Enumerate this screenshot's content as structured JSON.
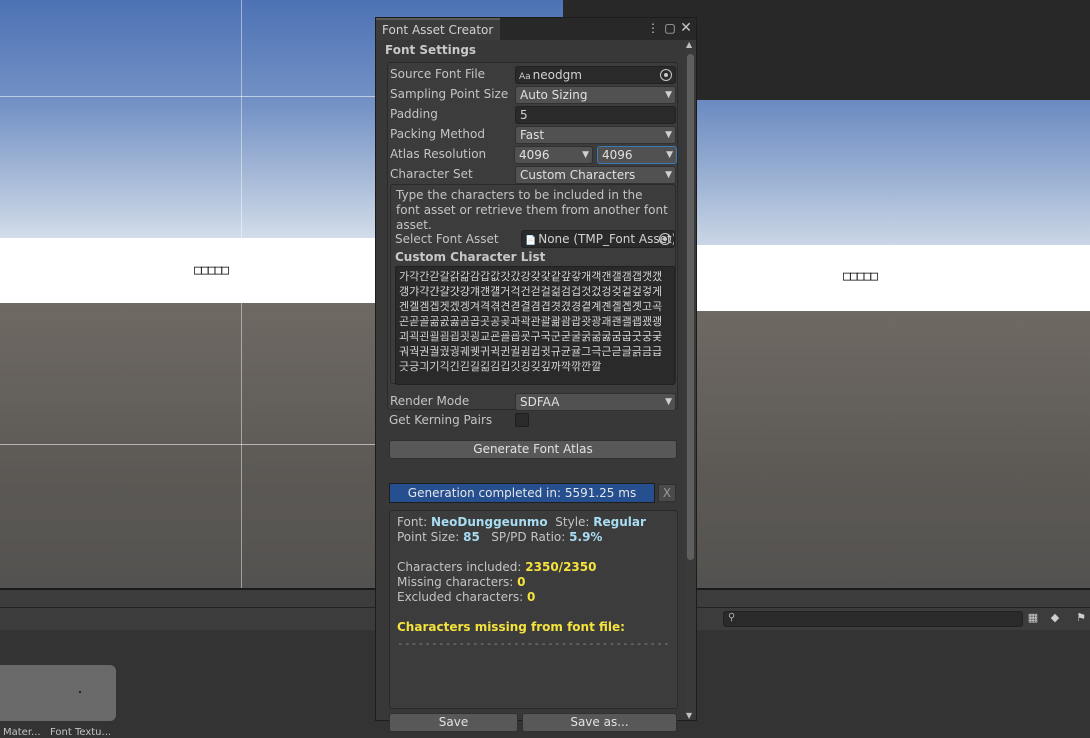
{
  "scene_left": {
    "glyphs": "□□□□□"
  },
  "scene_right": {
    "glyphs": "□□□□□"
  },
  "project": {
    "assets": [
      "Mater...",
      "Font Textu..."
    ]
  },
  "window": {
    "tab_title": "Font Asset Creator",
    "menu_icon": "kebab-menu-icon",
    "maximize_icon": "maximize-icon",
    "close_icon": "close-icon"
  },
  "settings": {
    "section_title": "Font Settings",
    "source_font_label": "Source Font File",
    "source_font_value": "neodgm",
    "sampling_label": "Sampling Point Size",
    "sampling_value": "Auto Sizing",
    "padding_label": "Padding",
    "padding_value": "5",
    "packing_label": "Packing Method",
    "packing_value": "Fast",
    "atlas_label": "Atlas Resolution",
    "atlas_width": "4096",
    "atlas_height": "4096",
    "charset_label": "Character Set",
    "charset_value": "Custom Characters",
    "charset_help": "Type the characters to be included in the font asset or retrieve them from another font asset.",
    "select_font_asset_label": "Select Font Asset",
    "select_font_asset_value": "None (TMP_Font Asset)",
    "custom_list_title": "Custom Character List",
    "custom_list_text": "가각간갇갈갉갊감갑값갓갔강갖갗같갚갛개객갠갤갬갭갯갰갱갸갹갼걀걋걍걔걘걜거걱건걷걸걺검겁것겄겅겆겉겊겋게겐겔겜겝겟겠겡겨격겪견겯결겸겹겻겼경곁계곈곌곕곗고곡곤곧골곪곬곯곰곱곳공곶과곽관괄괆괌괍괏광괘괜괠괩괬괭괴괵괸괼굄굅굇굉교굔굘굡굣구국군굳굴굵굶굻굼굽굿궁궂궈궉권궐궜궝궤궷귀귁귄귈귐귑귓규균귤그극근귿글긁금급긋긍긔기긱긴긷길긺김깁깃깅깆깊까깍깎깐깔",
    "render_mode_label": "Render Mode",
    "render_mode_value": "SDFAA",
    "kerning_label": "Get Kerning Pairs",
    "kerning_checked": false
  },
  "actions": {
    "generate_label": "Generate Font Atlas",
    "progress_text": "Generation completed in: 5591.25 ms",
    "progress_fraction": 1.0,
    "progress_close": "X",
    "save_label": "Save",
    "save_as_label": "Save as..."
  },
  "results": {
    "font_label": "Font:",
    "font_value": "NeoDunggeunmo",
    "style_label": "Style:",
    "style_value": "Regular",
    "point_size_label": "Point Size:",
    "point_size_value": "85",
    "ratio_label": "SP/PD Ratio:",
    "ratio_value": "5.9%",
    "included_label": "Characters included:",
    "included_value": "2350/2350",
    "missing_label": "Missing characters:",
    "missing_value": "0",
    "excluded_label": "Excluded characters:",
    "excluded_value": "0",
    "missing_title": "Characters missing from font file:",
    "divider": "----------------------------------------"
  },
  "colors": {
    "progress_fill": "#264f8f",
    "value_cyan": "#a8dcf2",
    "value_yellow": "#f5e33d"
  }
}
